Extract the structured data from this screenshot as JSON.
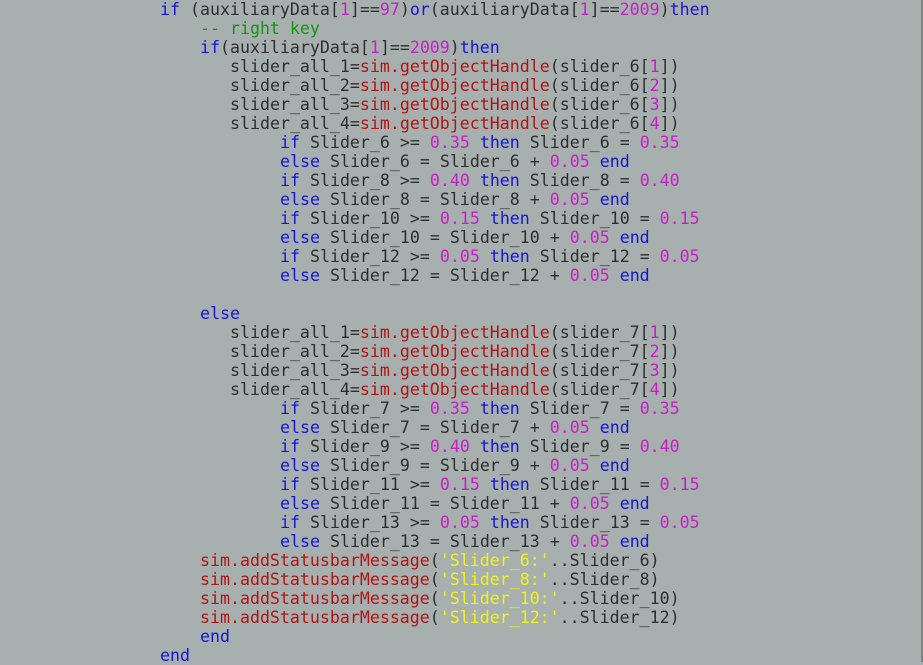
{
  "colors": {
    "background": "#a7b0ae",
    "keyword": "#1515d8",
    "number": "#c61fc6",
    "function": "#b01414",
    "comment": "#129612",
    "string": "#f2f21a",
    "text": "#2e2e2e"
  },
  "code_lines": [
    {
      "indent": 160,
      "tokens": [
        {
          "t": "if",
          "c": "kw"
        },
        {
          "t": " (auxiliaryData[",
          "c": "tx"
        },
        {
          "t": "1",
          "c": "num"
        },
        {
          "t": "]==",
          "c": "tx"
        },
        {
          "t": "97",
          "c": "num"
        },
        {
          "t": ")",
          "c": "tx"
        },
        {
          "t": "or",
          "c": "kw"
        },
        {
          "t": "(auxiliaryData[",
          "c": "tx"
        },
        {
          "t": "1",
          "c": "num"
        },
        {
          "t": "]==",
          "c": "tx"
        },
        {
          "t": "2009",
          "c": "num"
        },
        {
          "t": ")",
          "c": "tx"
        },
        {
          "t": "then",
          "c": "kw"
        }
      ]
    },
    {
      "indent": 200,
      "tokens": [
        {
          "t": "-- right key",
          "c": "cm"
        }
      ]
    },
    {
      "indent": 200,
      "tokens": [
        {
          "t": "if",
          "c": "kw"
        },
        {
          "t": "(auxiliaryData[",
          "c": "tx"
        },
        {
          "t": "1",
          "c": "num"
        },
        {
          "t": "]==",
          "c": "tx"
        },
        {
          "t": "2009",
          "c": "num"
        },
        {
          "t": ")",
          "c": "tx"
        },
        {
          "t": "then",
          "c": "kw"
        }
      ]
    },
    {
      "indent": 230,
      "tokens": [
        {
          "t": "slider_all_1=",
          "c": "tx"
        },
        {
          "t": "sim.getObjectHandle",
          "c": "fn"
        },
        {
          "t": "(slider_6[",
          "c": "tx"
        },
        {
          "t": "1",
          "c": "num"
        },
        {
          "t": "])",
          "c": "tx"
        }
      ]
    },
    {
      "indent": 230,
      "tokens": [
        {
          "t": "slider_all_2=",
          "c": "tx"
        },
        {
          "t": "sim.getObjectHandle",
          "c": "fn"
        },
        {
          "t": "(slider_6[",
          "c": "tx"
        },
        {
          "t": "2",
          "c": "num"
        },
        {
          "t": "])",
          "c": "tx"
        }
      ]
    },
    {
      "indent": 230,
      "tokens": [
        {
          "t": "slider_all_3=",
          "c": "tx"
        },
        {
          "t": "sim.getObjectHandle",
          "c": "fn"
        },
        {
          "t": "(slider_6[",
          "c": "tx"
        },
        {
          "t": "3",
          "c": "num"
        },
        {
          "t": "])",
          "c": "tx"
        }
      ]
    },
    {
      "indent": 230,
      "tokens": [
        {
          "t": "slider_all_4=",
          "c": "tx"
        },
        {
          "t": "sim.getObjectHandle",
          "c": "fn"
        },
        {
          "t": "(slider_6[",
          "c": "tx"
        },
        {
          "t": "4",
          "c": "num"
        },
        {
          "t": "])",
          "c": "tx"
        }
      ]
    },
    {
      "indent": 280,
      "tokens": [
        {
          "t": "if",
          "c": "kw"
        },
        {
          "t": " Slider_6 >= ",
          "c": "tx"
        },
        {
          "t": "0.35",
          "c": "num"
        },
        {
          "t": " ",
          "c": "tx"
        },
        {
          "t": "then",
          "c": "kw"
        },
        {
          "t": " Slider_6 = ",
          "c": "tx"
        },
        {
          "t": "0.35",
          "c": "num"
        }
      ]
    },
    {
      "indent": 280,
      "tokens": [
        {
          "t": "else",
          "c": "kw"
        },
        {
          "t": " Slider_6 = Slider_6 + ",
          "c": "tx"
        },
        {
          "t": "0.05",
          "c": "num"
        },
        {
          "t": " ",
          "c": "tx"
        },
        {
          "t": "end",
          "c": "kw"
        }
      ]
    },
    {
      "indent": 280,
      "tokens": [
        {
          "t": "if",
          "c": "kw"
        },
        {
          "t": " Slider_8 >= ",
          "c": "tx"
        },
        {
          "t": "0.40",
          "c": "num"
        },
        {
          "t": " ",
          "c": "tx"
        },
        {
          "t": "then",
          "c": "kw"
        },
        {
          "t": " Slider_8 = ",
          "c": "tx"
        },
        {
          "t": "0.40",
          "c": "num"
        }
      ]
    },
    {
      "indent": 280,
      "tokens": [
        {
          "t": "else",
          "c": "kw"
        },
        {
          "t": " Slider_8 = Slider_8 + ",
          "c": "tx"
        },
        {
          "t": "0.05",
          "c": "num"
        },
        {
          "t": " ",
          "c": "tx"
        },
        {
          "t": "end",
          "c": "kw"
        }
      ]
    },
    {
      "indent": 280,
      "tokens": [
        {
          "t": "if",
          "c": "kw"
        },
        {
          "t": " Slider_10 >= ",
          "c": "tx"
        },
        {
          "t": "0.15",
          "c": "num"
        },
        {
          "t": " ",
          "c": "tx"
        },
        {
          "t": "then",
          "c": "kw"
        },
        {
          "t": " Slider_10 = ",
          "c": "tx"
        },
        {
          "t": "0.15",
          "c": "num"
        }
      ]
    },
    {
      "indent": 280,
      "tokens": [
        {
          "t": "else",
          "c": "kw"
        },
        {
          "t": " Slider_10 = Slider_10 + ",
          "c": "tx"
        },
        {
          "t": "0.05",
          "c": "num"
        },
        {
          "t": " ",
          "c": "tx"
        },
        {
          "t": "end",
          "c": "kw"
        }
      ]
    },
    {
      "indent": 280,
      "tokens": [
        {
          "t": "if",
          "c": "kw"
        },
        {
          "t": " Slider_12 >= ",
          "c": "tx"
        },
        {
          "t": "0.05",
          "c": "num"
        },
        {
          "t": " ",
          "c": "tx"
        },
        {
          "t": "then",
          "c": "kw"
        },
        {
          "t": " Slider_12 = ",
          "c": "tx"
        },
        {
          "t": "0.05",
          "c": "num"
        }
      ]
    },
    {
      "indent": 280,
      "tokens": [
        {
          "t": "else",
          "c": "kw"
        },
        {
          "t": " Slider_12 = Slider_12 + ",
          "c": "tx"
        },
        {
          "t": "0.05",
          "c": "num"
        },
        {
          "t": " ",
          "c": "tx"
        },
        {
          "t": "end",
          "c": "kw"
        }
      ]
    },
    {
      "indent": 0,
      "tokens": []
    },
    {
      "indent": 200,
      "tokens": [
        {
          "t": "else",
          "c": "kw"
        }
      ]
    },
    {
      "indent": 230,
      "tokens": [
        {
          "t": "slider_all_1=",
          "c": "tx"
        },
        {
          "t": "sim.getObjectHandle",
          "c": "fn"
        },
        {
          "t": "(slider_7[",
          "c": "tx"
        },
        {
          "t": "1",
          "c": "num"
        },
        {
          "t": "])",
          "c": "tx"
        }
      ]
    },
    {
      "indent": 230,
      "tokens": [
        {
          "t": "slider_all_2=",
          "c": "tx"
        },
        {
          "t": "sim.getObjectHandle",
          "c": "fn"
        },
        {
          "t": "(slider_7[",
          "c": "tx"
        },
        {
          "t": "2",
          "c": "num"
        },
        {
          "t": "])",
          "c": "tx"
        }
      ]
    },
    {
      "indent": 230,
      "tokens": [
        {
          "t": "slider_all_3=",
          "c": "tx"
        },
        {
          "t": "sim.getObjectHandle",
          "c": "fn"
        },
        {
          "t": "(slider_7[",
          "c": "tx"
        },
        {
          "t": "3",
          "c": "num"
        },
        {
          "t": "])",
          "c": "tx"
        }
      ]
    },
    {
      "indent": 230,
      "tokens": [
        {
          "t": "slider_all_4=",
          "c": "tx"
        },
        {
          "t": "sim.getObjectHandle",
          "c": "fn"
        },
        {
          "t": "(slider_7[",
          "c": "tx"
        },
        {
          "t": "4",
          "c": "num"
        },
        {
          "t": "])",
          "c": "tx"
        }
      ]
    },
    {
      "indent": 280,
      "tokens": [
        {
          "t": "if",
          "c": "kw"
        },
        {
          "t": " Slider_7 >= ",
          "c": "tx"
        },
        {
          "t": "0.35",
          "c": "num"
        },
        {
          "t": " ",
          "c": "tx"
        },
        {
          "t": "then",
          "c": "kw"
        },
        {
          "t": " Slider_7 = ",
          "c": "tx"
        },
        {
          "t": "0.35",
          "c": "num"
        }
      ]
    },
    {
      "indent": 280,
      "tokens": [
        {
          "t": "else",
          "c": "kw"
        },
        {
          "t": " Slider_7 = Slider_7 + ",
          "c": "tx"
        },
        {
          "t": "0.05",
          "c": "num"
        },
        {
          "t": " ",
          "c": "tx"
        },
        {
          "t": "end",
          "c": "kw"
        }
      ]
    },
    {
      "indent": 280,
      "tokens": [
        {
          "t": "if",
          "c": "kw"
        },
        {
          "t": " Slider_9 >= ",
          "c": "tx"
        },
        {
          "t": "0.40",
          "c": "num"
        },
        {
          "t": " ",
          "c": "tx"
        },
        {
          "t": "then",
          "c": "kw"
        },
        {
          "t": " Slider_9 = ",
          "c": "tx"
        },
        {
          "t": "0.40",
          "c": "num"
        }
      ]
    },
    {
      "indent": 280,
      "tokens": [
        {
          "t": "else",
          "c": "kw"
        },
        {
          "t": " Slider_9 = Slider_9 + ",
          "c": "tx"
        },
        {
          "t": "0.05",
          "c": "num"
        },
        {
          "t": " ",
          "c": "tx"
        },
        {
          "t": "end",
          "c": "kw"
        }
      ]
    },
    {
      "indent": 280,
      "tokens": [
        {
          "t": "if",
          "c": "kw"
        },
        {
          "t": " Slider_11 >= ",
          "c": "tx"
        },
        {
          "t": "0.15",
          "c": "num"
        },
        {
          "t": " ",
          "c": "tx"
        },
        {
          "t": "then",
          "c": "kw"
        },
        {
          "t": " Slider_11 = ",
          "c": "tx"
        },
        {
          "t": "0.15",
          "c": "num"
        }
      ]
    },
    {
      "indent": 280,
      "tokens": [
        {
          "t": "else",
          "c": "kw"
        },
        {
          "t": " Slider_11 = Slider_11 + ",
          "c": "tx"
        },
        {
          "t": "0.05",
          "c": "num"
        },
        {
          "t": " ",
          "c": "tx"
        },
        {
          "t": "end",
          "c": "kw"
        }
      ]
    },
    {
      "indent": 280,
      "tokens": [
        {
          "t": "if",
          "c": "kw"
        },
        {
          "t": " Slider_13 >= ",
          "c": "tx"
        },
        {
          "t": "0.05",
          "c": "num"
        },
        {
          "t": " ",
          "c": "tx"
        },
        {
          "t": "then",
          "c": "kw"
        },
        {
          "t": " Slider_13 = ",
          "c": "tx"
        },
        {
          "t": "0.05",
          "c": "num"
        }
      ]
    },
    {
      "indent": 280,
      "tokens": [
        {
          "t": "else",
          "c": "kw"
        },
        {
          "t": " Slider_13 = Slider_13 + ",
          "c": "tx"
        },
        {
          "t": "0.05",
          "c": "num"
        },
        {
          "t": " ",
          "c": "tx"
        },
        {
          "t": "end",
          "c": "kw"
        }
      ]
    },
    {
      "indent": 200,
      "tokens": [
        {
          "t": "sim.addStatusbarMessage",
          "c": "fn"
        },
        {
          "t": "(",
          "c": "tx"
        },
        {
          "t": "'Slider_6:'",
          "c": "str"
        },
        {
          "t": "..Slider_6)",
          "c": "tx"
        }
      ]
    },
    {
      "indent": 200,
      "tokens": [
        {
          "t": "sim.addStatusbarMessage",
          "c": "fn"
        },
        {
          "t": "(",
          "c": "tx"
        },
        {
          "t": "'Slider_8:'",
          "c": "str"
        },
        {
          "t": "..Slider_8)",
          "c": "tx"
        }
      ]
    },
    {
      "indent": 200,
      "tokens": [
        {
          "t": "sim.addStatusbarMessage",
          "c": "fn"
        },
        {
          "t": "(",
          "c": "tx"
        },
        {
          "t": "'Slider_10:'",
          "c": "str"
        },
        {
          "t": "..Slider_10)",
          "c": "tx"
        }
      ]
    },
    {
      "indent": 200,
      "tokens": [
        {
          "t": "sim.addStatusbarMessage",
          "c": "fn"
        },
        {
          "t": "(",
          "c": "tx"
        },
        {
          "t": "'Slider_12:'",
          "c": "str"
        },
        {
          "t": "..Slider_12)",
          "c": "tx"
        }
      ]
    },
    {
      "indent": 200,
      "tokens": [
        {
          "t": "end",
          "c": "kw"
        }
      ]
    },
    {
      "indent": 160,
      "tokens": [
        {
          "t": "end",
          "c": "kw"
        }
      ]
    }
  ]
}
